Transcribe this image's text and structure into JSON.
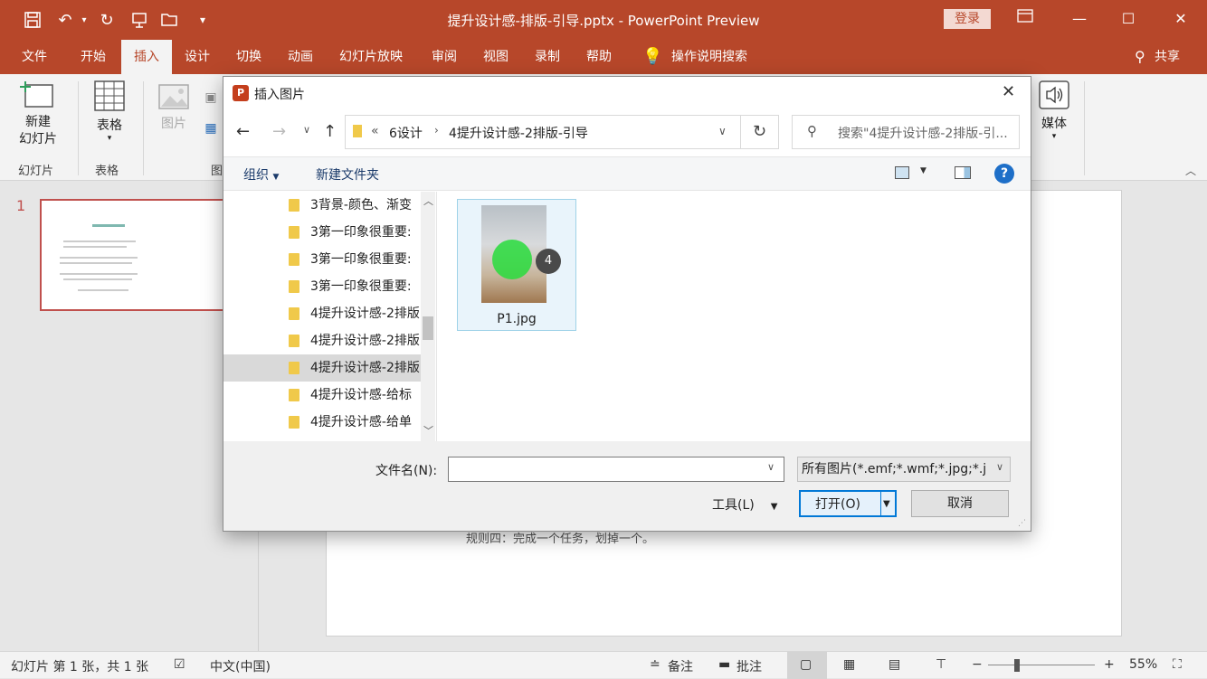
{
  "app": {
    "window_title": "提升设计感-排版-引导.pptx  -  PowerPoint Preview",
    "login_label": "登录",
    "share_label": "共享",
    "tell_me": "操作说明搜索"
  },
  "menu": {
    "tabs": [
      "文件",
      "开始",
      "插入",
      "设计",
      "切换",
      "动画",
      "幻灯片放映",
      "审阅",
      "视图",
      "录制",
      "帮助"
    ],
    "active_tab": "插入"
  },
  "ribbon": {
    "new_slide": "新建\n幻灯片",
    "new_slide_line1": "新建",
    "new_slide_line2": "幻灯片",
    "table": "表格",
    "picture": "图片",
    "media": "媒体",
    "group_slides": "幻灯片",
    "group_table": "表格",
    "group_images_partial": "图"
  },
  "slide_pane": {
    "slide_number": "1"
  },
  "canvas": {
    "visible_text": "规则四：完成一个任务，划掉一个。"
  },
  "dialog": {
    "title": "插入图片",
    "breadcrumb": [
      "6设计",
      "4提升设计感-2排版-引导"
    ],
    "breadcrumb_prefix": "«",
    "search_placeholder": "搜索\"4提升设计感-2排版-引...",
    "organize": "组织",
    "new_folder": "新建文件夹",
    "nav_items": [
      "3背景-颜色、渐变",
      "3第一印象很重要:",
      "3第一印象很重要:",
      "3第一印象很重要:",
      "4提升设计感-2排版",
      "4提升设计感-2排版",
      "4提升设计感-2排版",
      "4提升设计感-给标",
      "4提升设计感-给单"
    ],
    "selected_nav_index": 6,
    "file": {
      "name": "P1.jpg",
      "badge": "4"
    },
    "filename_label": "文件名(N):",
    "filename_value": "",
    "filetype_value": "所有图片(*.emf;*.wmf;*.jpg;*.j",
    "tools_label": "工具(L)",
    "open_label": "打开(O)",
    "cancel_label": "取消"
  },
  "status": {
    "slide_info": "幻灯片 第 1 张，共 1 张",
    "language": "中文(中国)",
    "notes": "备注",
    "comments": "批注",
    "zoom": "55%"
  },
  "colors": {
    "accent": "#b7472a",
    "dialog_selection": "#e9f4fb",
    "open_button_border": "#0078d7"
  }
}
